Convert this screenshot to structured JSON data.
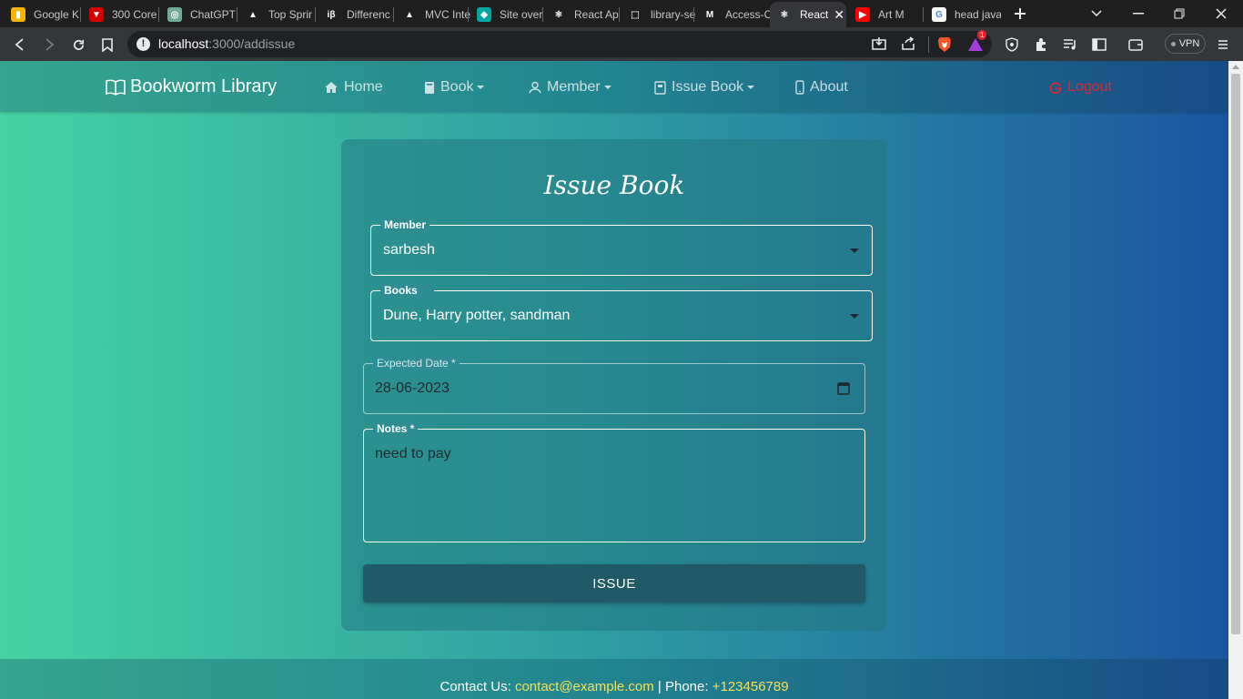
{
  "browser": {
    "tabs": [
      {
        "title": "Google K",
        "icon": "keep-icon",
        "color": "#f4b400",
        "glyph": "▮"
      },
      {
        "title": "300 Core",
        "icon": "tv-icon",
        "color": "#d50000",
        "glyph": "▼"
      },
      {
        "title": "ChatGPT",
        "icon": "chatgpt-icon",
        "color": "#74aa9c",
        "glyph": "◎"
      },
      {
        "title": "Top Sprir",
        "icon": "mountain-icon",
        "color": "#1f1f1f",
        "glyph": "▲"
      },
      {
        "title": "Differenc",
        "icon": "ib-icon",
        "color": "#1f1f1f",
        "glyph": "iβ"
      },
      {
        "title": "MVC Inte",
        "icon": "mountain-icon",
        "color": "#1f1f1f",
        "glyph": "▲"
      },
      {
        "title": "Site over",
        "icon": "diamond-icon",
        "color": "#00a7a0",
        "glyph": "◆"
      },
      {
        "title": "React Ap",
        "icon": "react-icon",
        "color": "#1f1f1f",
        "glyph": "⚛"
      },
      {
        "title": "library-se",
        "icon": "dashed-box-icon",
        "color": "#1f1f1f",
        "glyph": "⬚"
      },
      {
        "title": "Access-C",
        "icon": "medium-icon",
        "color": "#1f1f1f",
        "glyph": "M"
      },
      {
        "title": "React",
        "icon": "react-icon",
        "color": "#35363a",
        "glyph": "⚛",
        "active": true
      },
      {
        "title": "Art M",
        "icon": "youtube-icon",
        "color": "#ff0000",
        "glyph": "▶"
      },
      {
        "title": "head java",
        "icon": "google-icon",
        "color": "#ffffff",
        "glyph": "G"
      }
    ],
    "url_host": "localhost",
    "url_path": ":3000/addissue",
    "vpn_label": "VPN",
    "notification_count": "1"
  },
  "navbar": {
    "brand": "Bookworm Library",
    "items": [
      {
        "label": "Home",
        "icon": "home-icon"
      },
      {
        "label": "Book",
        "icon": "book-icon",
        "dropdown": true
      },
      {
        "label": "Member",
        "icon": "person-icon",
        "dropdown": true
      },
      {
        "label": "Issue Book",
        "icon": "journal-icon",
        "dropdown": true
      },
      {
        "label": "About",
        "icon": "phone-icon"
      }
    ],
    "logout": "Logout"
  },
  "form": {
    "title": "Issue Book",
    "member": {
      "label": "Member",
      "value": "sarbesh"
    },
    "books": {
      "label": "Books",
      "value": "Dune, Harry potter, sandman"
    },
    "expected_date": {
      "label": "Expected Date *",
      "value": "28-06-2023"
    },
    "notes": {
      "label": "Notes *",
      "value": "need to pay"
    },
    "submit_label": "ISSUE"
  },
  "footer": {
    "prefix": "Contact Us: ",
    "email": "contact@example.com",
    "separator": " | Phone: ",
    "phone": "+123456789"
  },
  "colors": {
    "gradient_start": "#45d3a3",
    "gradient_end": "#1b55a0",
    "logout": "#e0262f",
    "footer_highlight": "#f2e05a"
  }
}
